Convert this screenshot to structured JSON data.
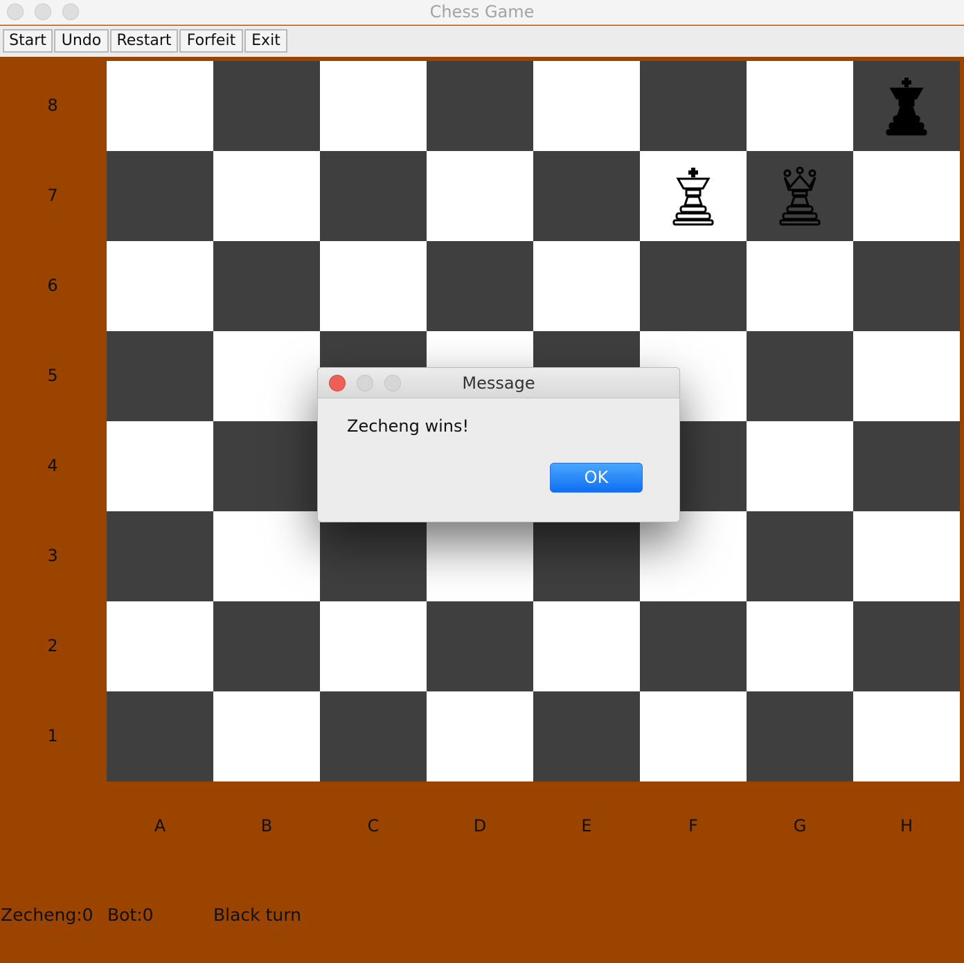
{
  "window": {
    "title": "Chess Game"
  },
  "toolbar": {
    "buttons": [
      {
        "label": "Start"
      },
      {
        "label": "Undo"
      },
      {
        "label": "Restart"
      },
      {
        "label": "Forfeit"
      },
      {
        "label": "Exit"
      }
    ]
  },
  "board": {
    "ranks": [
      "8",
      "7",
      "6",
      "5",
      "4",
      "3",
      "2",
      "1"
    ],
    "files": [
      "A",
      "B",
      "C",
      "D",
      "E",
      "F",
      "G",
      "H"
    ],
    "pieces": [
      {
        "square": "H8",
        "color": "black",
        "type": "king",
        "icon": "black-king-icon"
      },
      {
        "square": "F7",
        "color": "white",
        "type": "king",
        "icon": "white-king-icon"
      },
      {
        "square": "G7",
        "color": "black",
        "type": "queen",
        "icon": "black-queen-icon",
        "style": "outline"
      }
    ],
    "colors": {
      "light": "#ffffff",
      "dark": "#3f3f3f",
      "frame": "#9a4400"
    }
  },
  "status": {
    "player_score": "Zecheng:0",
    "bot_score": "Bot:0",
    "turn": "Black turn"
  },
  "dialog": {
    "title": "Message",
    "message": "Zecheng wins!",
    "ok_label": "OK"
  }
}
